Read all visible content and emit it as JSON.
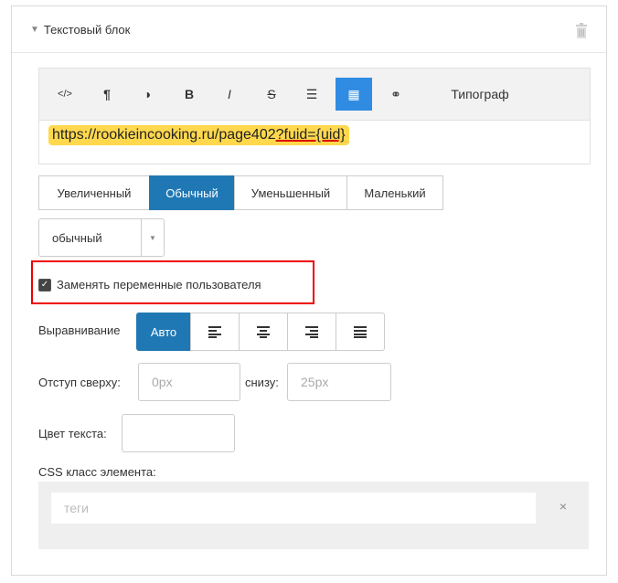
{
  "panel": {
    "title": "Текстовый блок"
  },
  "toolbar": {
    "buttons": [
      {
        "label": "</>",
        "name": "code-button"
      },
      {
        "label": "¶",
        "name": "paragraph-button"
      },
      {
        "label": "◑",
        "name": "contrast-button"
      },
      {
        "label": "B",
        "name": "bold-button"
      },
      {
        "label": "I",
        "name": "italic-button"
      },
      {
        "label": "S",
        "name": "strike-button"
      },
      {
        "label": "☰",
        "name": "list-button"
      },
      {
        "label": "▦",
        "name": "table-button"
      },
      {
        "label": "⚭",
        "name": "link-button"
      },
      {
        "label": "Типограф",
        "name": "typograph-button"
      }
    ]
  },
  "editor": {
    "text_prefix": "https://rookieincooking.ru/page402",
    "text_highlight": "?fuid={uid}"
  },
  "size_buttons": [
    "Увеличенный",
    "Обычный",
    "Уменьшенный",
    "Маленький"
  ],
  "weight_select": {
    "value": "обычный"
  },
  "replace_vars": {
    "label": "Заменять переменные пользователя",
    "checked": true
  },
  "alignment": {
    "label": "Выравнивание",
    "auto": "Авто"
  },
  "margin": {
    "top_label": "Отступ сверху:",
    "top_placeholder": "0px",
    "bottom_label": "снизу:",
    "bottom_placeholder": "25px"
  },
  "text_color": {
    "label": "Цвет текста:"
  },
  "css_class": {
    "label": "CSS класс элемента:",
    "placeholder": "теги",
    "clear": "×"
  },
  "colors": {
    "accent": "#1f78b4",
    "highlight": "#ffd84d",
    "callout": "#e00000"
  }
}
